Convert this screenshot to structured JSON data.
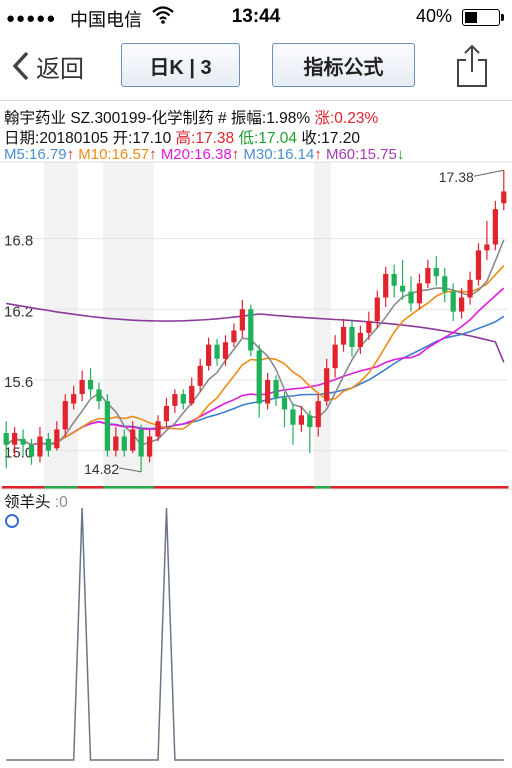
{
  "status_bar": {
    "carrier": "中国电信",
    "time": "13:44",
    "battery_pct": "40%",
    "battery_level": 0.4,
    "signal_icon": "signal-dots-icon",
    "wifi_icon": "wifi-icon"
  },
  "nav": {
    "back_label": "返回",
    "period_label": "日K | 3",
    "formula_label": "指标公式",
    "share_icon": "share-icon"
  },
  "stock": {
    "name": "翰宇药业",
    "code": "SZ.300199",
    "industry": "-化学制药",
    "amp_label": "# 振幅:",
    "amp_value": "1.98%",
    "chg_label": "涨:",
    "chg_value": "0.23%",
    "date_label": "日期:",
    "date_value": "20180105",
    "open_label": "开:",
    "open_value": "17.10",
    "high_label": "高:",
    "high_value": "17.38",
    "low_label": "低:",
    "low_value": "17.04",
    "close_label": "收:",
    "close_value": "17.20"
  },
  "ma": [
    {
      "label": "M5:",
      "value": "16.79",
      "arrow": "↑",
      "color": "#4a8fd0"
    },
    {
      "label": "M10:",
      "value": "16.57",
      "arrow": "↑",
      "color": "#ef8a17"
    },
    {
      "label": "M20:",
      "value": "16.38",
      "arrow": "↑",
      "color": "#e21ae0"
    },
    {
      "label": "M30:",
      "value": "16.14",
      "arrow": "↑",
      "color": "#4a8fd0"
    },
    {
      "label": "M60:",
      "value": "15.75",
      "arrow": "↓",
      "color": "#a43cb0"
    }
  ],
  "colors": {
    "up": "#e0232d",
    "down": "#1fb05a",
    "ma5": "#8a8a8a",
    "ma10": "#ef8a17",
    "ma20": "#e21ae0",
    "ma30": "#3c7fd0",
    "ma60": "#8a3a9a"
  },
  "chart_data": [
    {
      "type": "candlestick",
      "y_ticks": [
        "16.8",
        "16.2",
        "15.6",
        "15.0"
      ],
      "y_tick_values": [
        16.8,
        16.2,
        15.6,
        15.0
      ],
      "ylim": [
        14.7,
        17.45
      ],
      "max_label": "17.38",
      "min_label": "14.82",
      "shaded_spans": [
        [
          5,
          8
        ],
        [
          12,
          17
        ],
        [
          37,
          38
        ]
      ],
      "candles": [
        [
          15.15,
          15.05,
          15.25,
          14.85
        ],
        [
          15.05,
          15.15,
          15.2,
          14.95
        ],
        [
          15.1,
          15.05,
          15.18,
          14.95
        ],
        [
          15.05,
          14.95,
          15.1,
          14.88
        ],
        [
          14.95,
          15.12,
          15.2,
          14.9
        ],
        [
          15.1,
          15.0,
          15.15,
          14.95
        ],
        [
          15.02,
          15.18,
          15.25,
          15.0
        ],
        [
          15.18,
          15.42,
          15.48,
          15.12
        ],
        [
          15.4,
          15.48,
          15.55,
          15.35
        ],
        [
          15.48,
          15.6,
          15.68,
          15.42
        ],
        [
          15.6,
          15.52,
          15.7,
          15.45
        ],
        [
          15.52,
          15.42,
          15.58,
          15.35
        ],
        [
          15.42,
          15.0,
          15.48,
          14.95
        ],
        [
          15.0,
          15.12,
          15.2,
          14.95
        ],
        [
          15.12,
          15.0,
          15.18,
          14.95
        ],
        [
          15.0,
          15.18,
          15.25,
          14.98
        ],
        [
          15.18,
          14.95,
          15.22,
          14.82
        ],
        [
          14.95,
          15.12,
          15.18,
          14.9
        ],
        [
          15.12,
          15.25,
          15.3,
          15.08
        ],
        [
          15.25,
          15.38,
          15.45,
          15.2
        ],
        [
          15.38,
          15.48,
          15.52,
          15.32
        ],
        [
          15.48,
          15.4,
          15.52,
          15.35
        ],
        [
          15.4,
          15.55,
          15.62,
          15.38
        ],
        [
          15.55,
          15.72,
          15.78,
          15.5
        ],
        [
          15.72,
          15.9,
          15.96,
          15.68
        ],
        [
          15.9,
          15.78,
          15.95,
          15.72
        ],
        [
          15.78,
          15.92,
          15.98,
          15.72
        ],
        [
          15.92,
          16.02,
          16.08,
          15.88
        ],
        [
          16.02,
          16.2,
          16.28,
          15.96
        ],
        [
          16.2,
          15.85,
          16.24,
          15.8
        ],
        [
          15.85,
          15.4,
          15.9,
          15.28
        ],
        [
          15.4,
          15.6,
          15.66,
          15.35
        ],
        [
          15.6,
          15.45,
          15.64,
          15.38
        ],
        [
          15.45,
          15.35,
          15.5,
          15.2
        ],
        [
          15.35,
          15.22,
          15.4,
          15.05
        ],
        [
          15.22,
          15.3,
          15.38,
          15.16
        ],
        [
          15.3,
          15.2,
          15.34,
          14.98
        ],
        [
          15.2,
          15.42,
          15.48,
          15.12
        ],
        [
          15.42,
          15.7,
          15.78,
          15.38
        ],
        [
          15.7,
          15.9,
          15.98,
          15.62
        ],
        [
          15.9,
          16.05,
          16.12,
          15.84
        ],
        [
          16.05,
          15.88,
          16.1,
          15.8
        ],
        [
          15.88,
          16.0,
          16.06,
          15.82
        ],
        [
          16.0,
          16.1,
          16.18,
          15.94
        ],
        [
          16.1,
          16.3,
          16.36,
          16.04
        ],
        [
          16.3,
          16.5,
          16.56,
          16.22
        ],
        [
          16.5,
          16.4,
          16.58,
          16.3
        ],
        [
          16.4,
          16.35,
          16.62,
          16.28
        ],
        [
          16.35,
          16.25,
          16.48,
          16.18
        ],
        [
          16.25,
          16.42,
          16.5,
          16.2
        ],
        [
          16.42,
          16.55,
          16.62,
          16.38
        ],
        [
          16.55,
          16.48,
          16.65,
          16.4
        ],
        [
          16.48,
          16.35,
          16.55,
          16.26
        ],
        [
          16.35,
          16.18,
          16.42,
          16.1
        ],
        [
          16.18,
          16.3,
          16.38,
          16.12
        ],
        [
          16.3,
          16.45,
          16.52,
          16.24
        ],
        [
          16.45,
          16.7,
          16.76,
          16.4
        ],
        [
          16.7,
          16.75,
          16.95,
          16.62
        ],
        [
          16.75,
          17.05,
          17.12,
          16.7
        ],
        [
          17.1,
          17.2,
          17.38,
          17.04
        ]
      ],
      "ma5_last": 16.79,
      "ma10_last": 16.57,
      "ma20_last": 16.38,
      "ma30_last": 16.14,
      "ma60_last": 15.75
    },
    {
      "type": "line",
      "title": "领羊头",
      "value_label": ":0",
      "ylim": [
        0,
        1
      ],
      "spikes_at": [
        9,
        19
      ],
      "length": 60
    }
  ]
}
